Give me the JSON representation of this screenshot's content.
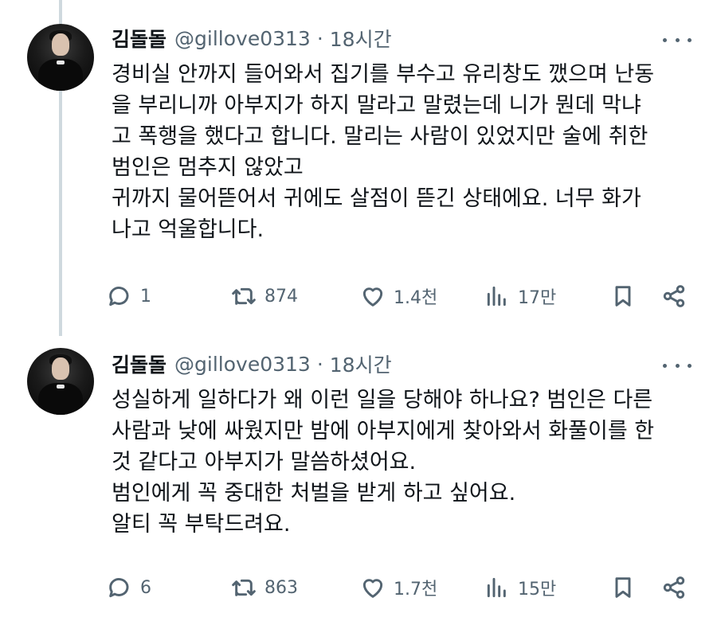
{
  "tweets": [
    {
      "name": "김돌돌",
      "handle": "@gillove0313",
      "separator": "·",
      "time": "18시간",
      "text": "경비실 안까지 들어와서 집기를 부수고 유리창도 깼으며 난동\n을 부리니까 아부지가 하지 말라고 말렸는데 니가 뭔데 막냐\n고 폭행을 했다고 합니다. 말리는 사람이 있었지만 술에 취한\n범인은 멈추지 않았고\n귀까지 물어뜯어서 귀에도 살점이 뜯긴 상태에요. 너무 화가\n나고 억울합니다.",
      "replies": "1",
      "retweets": "874",
      "likes": "1.4천",
      "views": "17만"
    },
    {
      "name": "김돌돌",
      "handle": "@gillove0313",
      "separator": "·",
      "time": "18시간",
      "text": "성실하게 일하다가 왜 이런 일을 당해야 하나요? 범인은 다른\n사람과 낮에 싸웠지만 밤에 아부지에게 찾아와서 화풀이를 한\n것 같다고 아부지가 말씀하셨어요.\n범인에게 꼭 중대한 처벌을 받게 하고 싶어요.\n알티 꼭 부탁드려요.",
      "replies": "6",
      "retweets": "863",
      "likes": "1.7천",
      "views": "15만"
    }
  ],
  "icons": {
    "reply": "speech-bubble",
    "retweet": "retweet-arrows",
    "like": "heart",
    "views": "bar-chart",
    "bookmark": "bookmark",
    "share": "share-nodes",
    "more": "three-dots"
  },
  "colors": {
    "text": "#0f1419",
    "secondary": "#536471",
    "thread_line": "#cfd9de",
    "background": "#ffffff"
  }
}
